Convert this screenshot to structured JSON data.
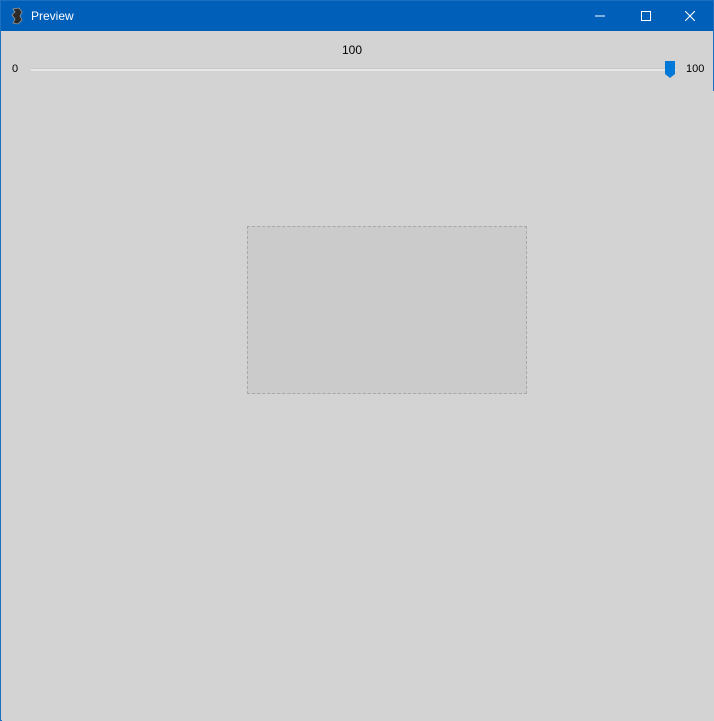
{
  "window": {
    "title": "Preview",
    "icon": "app-icon",
    "controls": [
      "minimize-icon",
      "maximize-icon",
      "close-icon"
    ]
  },
  "slider": {
    "value": "100",
    "min_label": "0",
    "max_label": "100",
    "value_fraction": 1.0
  },
  "colors": {
    "titlebar": "#005fb8",
    "background": "#d3d3d3",
    "accent": "#0078d7"
  }
}
